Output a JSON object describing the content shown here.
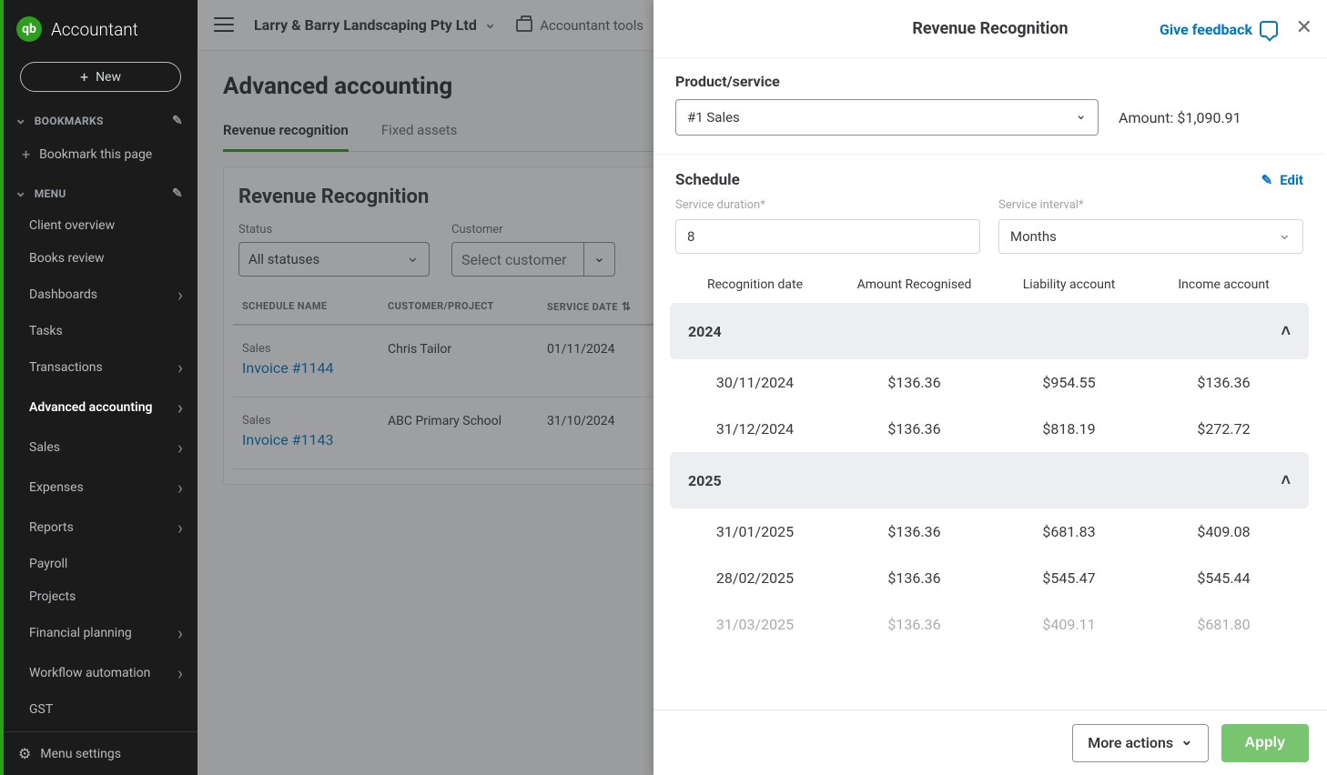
{
  "app_title": "Accountant",
  "new_button": "New",
  "bookmarks_heading": "BOOKMARKS",
  "bookmark_page_label": "Bookmark this page",
  "menu_heading": "MENU",
  "menu_items": [
    {
      "label": "Client overview",
      "chev": false
    },
    {
      "label": "Books review",
      "chev": false
    },
    {
      "label": "Dashboards",
      "chev": true
    },
    {
      "label": "Tasks",
      "chev": false
    },
    {
      "label": "Transactions",
      "chev": true
    },
    {
      "label": "Advanced accounting",
      "chev": true,
      "active": true
    },
    {
      "label": "Sales",
      "chev": true
    },
    {
      "label": "Expenses",
      "chev": true
    },
    {
      "label": "Reports",
      "chev": true
    },
    {
      "label": "Payroll",
      "chev": false
    },
    {
      "label": "Projects",
      "chev": false
    },
    {
      "label": "Financial planning",
      "chev": true
    },
    {
      "label": "Workflow automation",
      "chev": true
    },
    {
      "label": "GST",
      "chev": false
    }
  ],
  "menu_settings_label": "Menu settings",
  "company_name": "Larry & Barry Landscaping Pty Ltd",
  "accountant_tools_label": "Accountant tools",
  "page_title": "Advanced accounting",
  "tabs": {
    "tab1": "Revenue recognition",
    "tab2": "Fixed assets"
  },
  "panel_title": "Revenue Recognition",
  "filters": {
    "status_label": "Status",
    "status_value": "All statuses",
    "customer_label": "Customer",
    "customer_value": "Select customer"
  },
  "columns": {
    "sched": "SCHEDULE NAME",
    "cust": "CUSTOMER/PROJECT",
    "date": "SERVICE DATE"
  },
  "rows": [
    {
      "sched_label": "Sales",
      "sched_link": "Invoice #1144",
      "cust": "Chris Tailor",
      "date": "01/11/2024"
    },
    {
      "sched_label": "Sales",
      "sched_link": "Invoice #1143",
      "cust": "ABC Primary School",
      "date": "31/10/2024"
    }
  ],
  "drawer": {
    "title": "Revenue Recognition",
    "feedback": "Give feedback",
    "ps_label": "Product/service",
    "ps_value": "#1 Sales",
    "amount_label": "Amount: ",
    "amount_value": "$1,090.91",
    "schedule_title": "Schedule",
    "edit_label": "Edit",
    "duration_label": "Service duration*",
    "duration_value": "8",
    "interval_label": "Service interval*",
    "interval_value": "Months",
    "gcols": {
      "date": "Recognition date",
      "amt": "Amount Recognised",
      "lia": "Liability account",
      "inc": "Income account"
    },
    "years": [
      {
        "year": "2024",
        "rows": [
          {
            "date": "30/11/2024",
            "amt": "$136.36",
            "lia": "$954.55",
            "inc": "$136.36"
          },
          {
            "date": "31/12/2024",
            "amt": "$136.36",
            "lia": "$818.19",
            "inc": "$272.72"
          }
        ]
      },
      {
        "year": "2025",
        "rows": [
          {
            "date": "31/01/2025",
            "amt": "$136.36",
            "lia": "$681.83",
            "inc": "$409.08"
          },
          {
            "date": "28/02/2025",
            "amt": "$136.36",
            "lia": "$545.47",
            "inc": "$545.44"
          },
          {
            "date": "31/03/2025",
            "amt": "$136.36",
            "lia": "$409.11",
            "inc": "$681.80",
            "muted": true
          }
        ]
      }
    ],
    "more_actions": "More actions",
    "apply": "Apply"
  }
}
